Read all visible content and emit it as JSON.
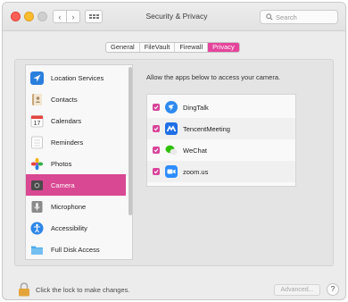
{
  "window": {
    "title": "Security & Privacy"
  },
  "toolbar": {
    "back_glyph": "‹",
    "forward_glyph": "›",
    "search_placeholder": "Search"
  },
  "tabs": [
    {
      "label": "General",
      "active": false
    },
    {
      "label": "FileVault",
      "active": false
    },
    {
      "label": "Firewall",
      "active": false
    },
    {
      "label": "Privacy",
      "active": true
    }
  ],
  "sidebar": {
    "items": [
      {
        "label": "Location Services",
        "icon": "location-arrow-icon"
      },
      {
        "label": "Contacts",
        "icon": "contacts-book-icon"
      },
      {
        "label": "Calendars",
        "icon": "calendar-icon"
      },
      {
        "label": "Reminders",
        "icon": "reminders-list-icon"
      },
      {
        "label": "Photos",
        "icon": "photos-flower-icon"
      },
      {
        "label": "Camera",
        "icon": "camera-icon",
        "selected": true
      },
      {
        "label": "Microphone",
        "icon": "microphone-icon"
      },
      {
        "label": "Accessibility",
        "icon": "accessibility-icon"
      },
      {
        "label": "Full Disk Access",
        "icon": "folder-icon"
      }
    ]
  },
  "main": {
    "prompt": "Allow the apps below to access your camera.",
    "apps": [
      {
        "name": "DingTalk",
        "checked": true,
        "icon": "dingtalk-icon"
      },
      {
        "name": "TencentMeeting",
        "checked": true,
        "icon": "tencent-meeting-icon"
      },
      {
        "name": "WeChat",
        "checked": true,
        "icon": "wechat-icon"
      },
      {
        "name": "zoom.us",
        "checked": true,
        "icon": "zoom-icon"
      }
    ]
  },
  "footer": {
    "lock_text": "Click the lock to make changes.",
    "advanced_label": "Advanced...",
    "help_label": "?"
  },
  "colors": {
    "accent": "#e5449c",
    "selection": "#d94893",
    "checkbox": "#d8449a"
  }
}
